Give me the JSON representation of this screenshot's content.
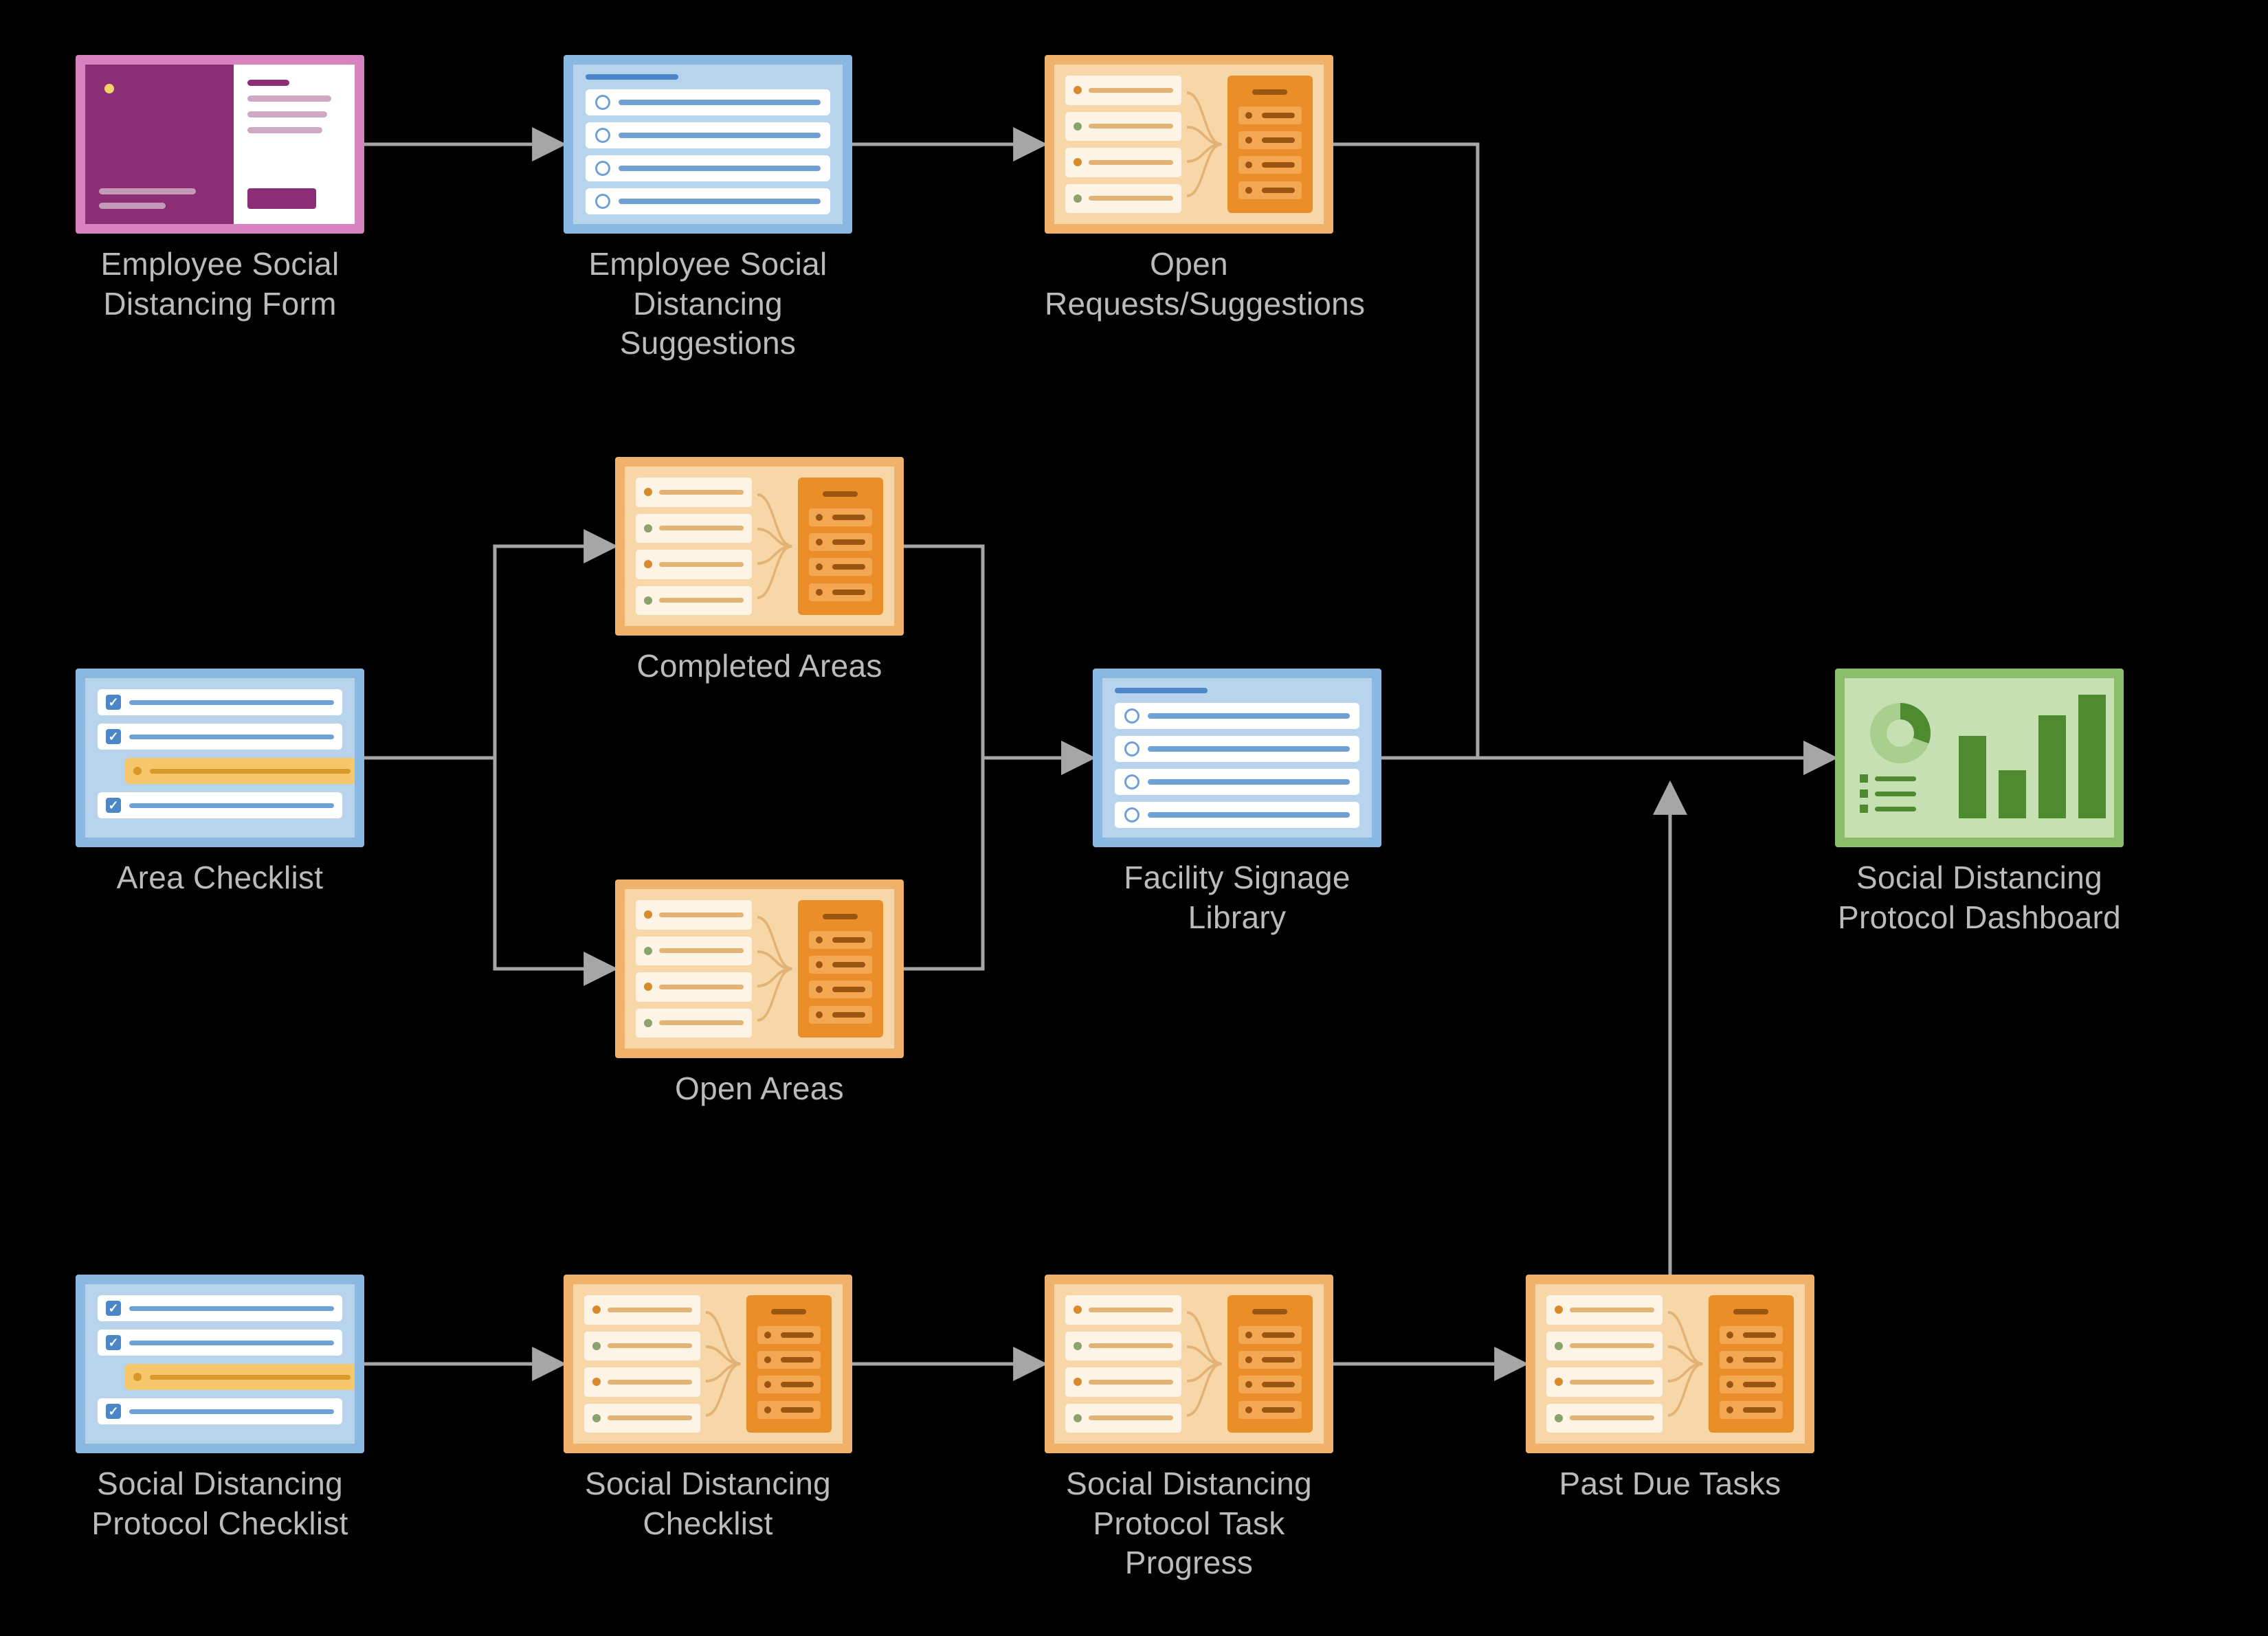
{
  "nodes": {
    "employee_form": {
      "label": "Employee Social Distancing Form",
      "type": "form"
    },
    "employee_suggestions": {
      "label": "Employee Social Distancing Suggestions",
      "type": "sheet"
    },
    "open_requests": {
      "label": "Open Requests/Suggestions",
      "type": "report"
    },
    "area_checklist": {
      "label": "Area Checklist",
      "type": "checklist"
    },
    "completed_areas": {
      "label": "Completed Areas",
      "type": "report"
    },
    "open_areas": {
      "label": "Open Areas",
      "type": "report"
    },
    "facility_signage_library": {
      "label": "Facility Signage Library",
      "type": "sheet"
    },
    "protocol_checklist": {
      "label": "Social Distancing Protocol Checklist",
      "type": "checklist"
    },
    "sd_checklist": {
      "label": "Social Distancing Checklist",
      "type": "report"
    },
    "task_progress": {
      "label": "Social Distancing Protocol Task Progress",
      "type": "report"
    },
    "past_due": {
      "label": "Past Due Tasks",
      "type": "report"
    },
    "dashboard": {
      "label": "Social Distancing Protocol Dashboard",
      "type": "dashboard"
    }
  },
  "edges": [
    [
      "employee_form",
      "employee_suggestions"
    ],
    [
      "employee_suggestions",
      "open_requests"
    ],
    [
      "open_requests",
      "dashboard"
    ],
    [
      "area_checklist",
      "completed_areas"
    ],
    [
      "area_checklist",
      "open_areas"
    ],
    [
      "completed_areas",
      "facility_signage_library"
    ],
    [
      "open_areas",
      "facility_signage_library"
    ],
    [
      "facility_signage_library",
      "dashboard"
    ],
    [
      "protocol_checklist",
      "sd_checklist"
    ],
    [
      "sd_checklist",
      "task_progress"
    ],
    [
      "task_progress",
      "past_due"
    ],
    [
      "past_due",
      "dashboard"
    ]
  ]
}
